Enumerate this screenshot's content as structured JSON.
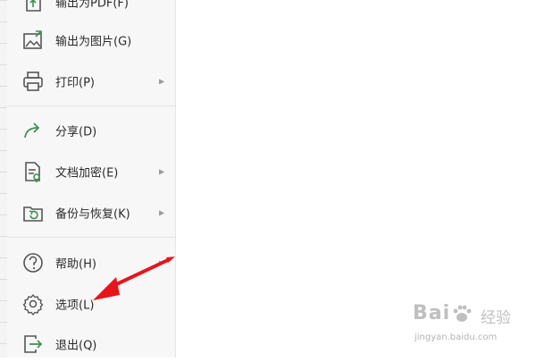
{
  "menu": {
    "items": [
      {
        "key": "export-pdf",
        "label": "输出为PDF(F)",
        "icon": "pdf-export-icon",
        "submenu": false
      },
      {
        "key": "export-image",
        "label": "输出为图片(G)",
        "icon": "image-export-icon",
        "submenu": false
      },
      {
        "key": "print",
        "label": "打印(P)",
        "icon": "printer-icon",
        "submenu": true
      },
      {
        "key": "share",
        "label": "分享(D)",
        "icon": "share-icon",
        "submenu": false
      },
      {
        "key": "encrypt",
        "label": "文档加密(E)",
        "icon": "document-lock-icon",
        "submenu": true
      },
      {
        "key": "backup",
        "label": "备份与恢复(K)",
        "icon": "backup-restore-icon",
        "submenu": true
      },
      {
        "key": "help",
        "label": "帮助(H)",
        "icon": "help-icon",
        "submenu": true
      },
      {
        "key": "options",
        "label": "选项(L)",
        "icon": "gear-icon",
        "submenu": false
      },
      {
        "key": "exit",
        "label": "退出(Q)",
        "icon": "exit-icon",
        "submenu": false
      }
    ],
    "submenu_glyph": "▶"
  },
  "annotation": {
    "arrow_color": "#e8141b",
    "points_to": "选项(L)"
  },
  "watermark": {
    "brand": "Bai",
    "brand_cn": "经验",
    "url": "jingyan.baidu.com"
  },
  "colors": {
    "menu_bg": "#f7f7f7",
    "icon_green": "#3f8f4f",
    "icon_gray": "#555555"
  }
}
